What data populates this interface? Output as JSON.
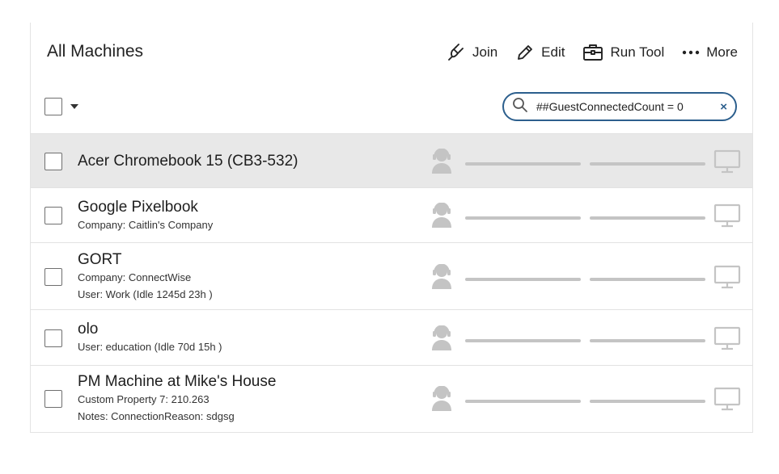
{
  "header": {
    "title": "All Machines",
    "toolbar": {
      "join_label": "Join",
      "edit_label": "Edit",
      "run_tool_label": "Run Tool",
      "more_label": "More"
    }
  },
  "search": {
    "value": "##GuestConnectedCount = 0",
    "clear_symbol": "×"
  },
  "machines": [
    {
      "name": "Acer Chromebook 15 (CB3-532)",
      "details": [],
      "selected": true
    },
    {
      "name": "Google Pixelbook",
      "details": [
        "Company: Caitlin's Company"
      ],
      "selected": false
    },
    {
      "name": "GORT",
      "details": [
        "Company: ConnectWise",
        "User: Work (Idle 1245d 23h )"
      ],
      "selected": false
    },
    {
      "name": "olo",
      "details": [
        "User: education (Idle 70d 15h )"
      ],
      "selected": false
    },
    {
      "name": "PM Machine at Mike's House",
      "details": [
        "Custom Property 7: 210.263",
        "Notes: ConnectionReason: sdgsg"
      ],
      "selected": false
    }
  ],
  "icons": {
    "join": "plug-icon",
    "edit": "pencil-icon",
    "run_tool": "toolbox-icon",
    "more": "ellipsis-icon",
    "search": "search-icon",
    "guest": "user-headset-icon",
    "host": "monitor-icon"
  },
  "colors": {
    "accent": "#2c5f8d",
    "selected_row": "#e8e8e8",
    "status_gray": "#c4c4c4"
  }
}
